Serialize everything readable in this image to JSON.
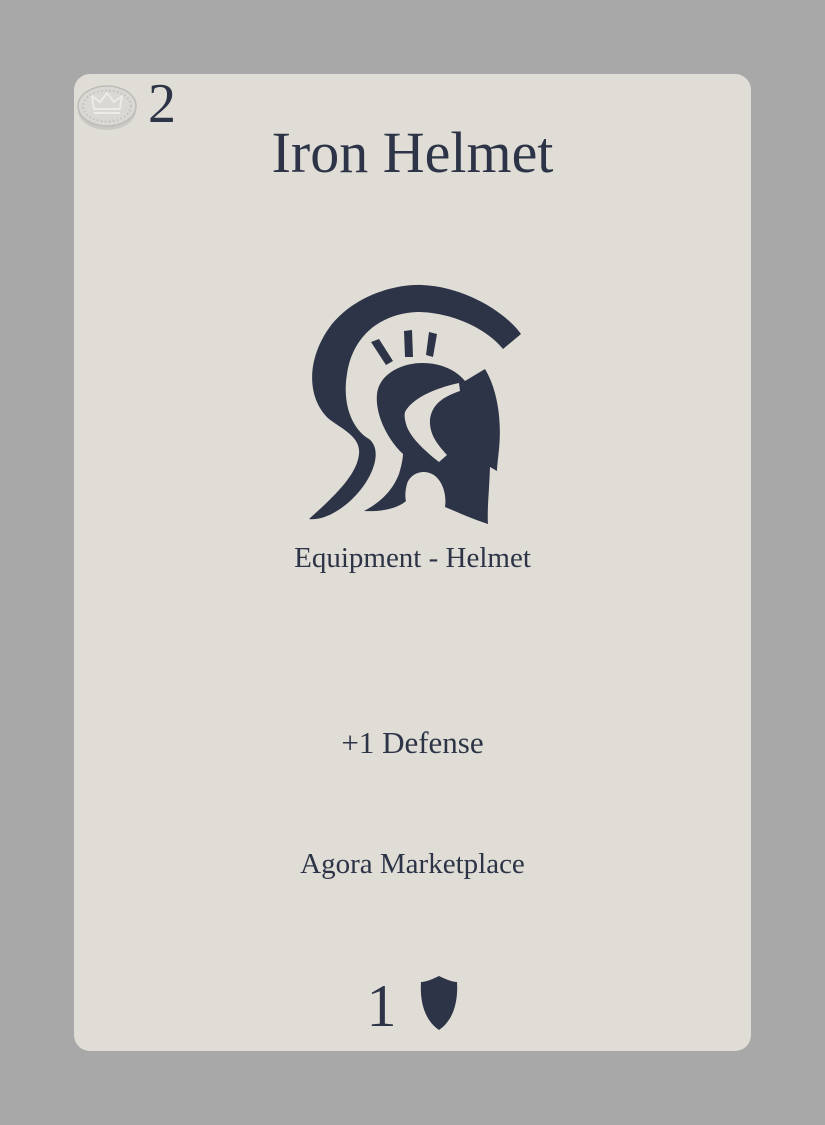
{
  "card": {
    "cost": "2",
    "cost_icon": "coin-crown-icon",
    "title": "Iron Helmet",
    "art_icon": "spartan-helmet-icon",
    "type_line": "Equipment - Helmet",
    "effect": "+1 Defense",
    "source": "Agora Marketplace",
    "stat_value": "1",
    "stat_icon": "shield-icon"
  },
  "colors": {
    "background": "#a8a8a8",
    "card": "#dfddd5",
    "ink": "#2d3447",
    "coin": "#d6d5d1"
  }
}
